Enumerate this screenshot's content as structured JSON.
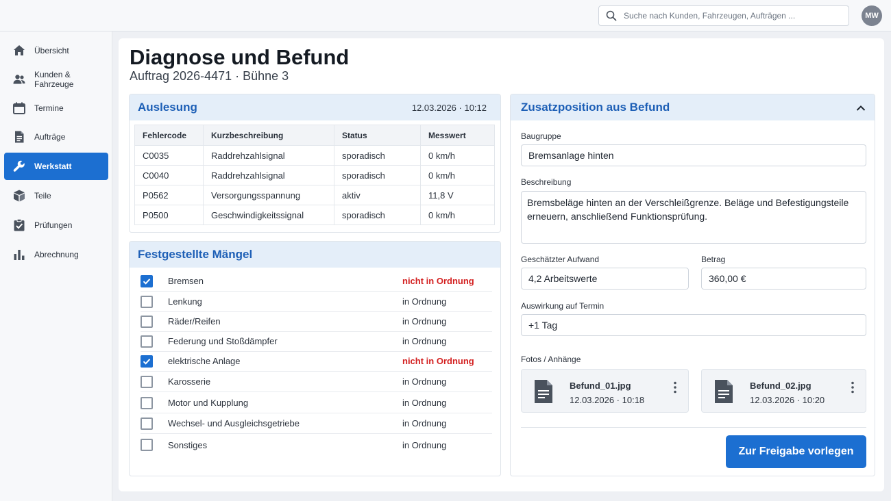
{
  "topbar": {
    "search_placeholder": "Suche nach Kunden, Fahrzeugen, Aufträgen ...",
    "avatar_initials": "MW"
  },
  "sidebar": {
    "items": [
      {
        "label": "Übersicht",
        "icon": "home-icon"
      },
      {
        "label": "Kunden & Fahrzeuge",
        "icon": "users-icon"
      },
      {
        "label": "Termine",
        "icon": "calendar-icon"
      },
      {
        "label": "Aufträge",
        "icon": "document-icon"
      },
      {
        "label": "Werkstatt",
        "icon": "wrench-icon",
        "active": true
      },
      {
        "label": "Teile",
        "icon": "box-icon"
      },
      {
        "label": "Prüfungen",
        "icon": "checklist-icon"
      },
      {
        "label": "Abrechnung",
        "icon": "bar-chart-icon"
      }
    ]
  },
  "page": {
    "title": "Diagnose und Befund",
    "subtitle": "Auftrag 2026-4471 · Bühne 3"
  },
  "readout": {
    "title": "Auslesung",
    "timestamp": "12.03.2026 · 10:12",
    "columns": [
      "Fehlercode",
      "Kurzbeschreibung",
      "Status",
      "Messwert"
    ],
    "rows": [
      [
        "C0035",
        "Raddrehzahlsignal",
        "sporadisch",
        "0 km/h"
      ],
      [
        "C0040",
        "Raddrehzahlsignal",
        "sporadisch",
        "0 km/h"
      ],
      [
        "P0562",
        "Versorgungsspannung",
        "aktiv",
        "11,8 V"
      ],
      [
        "P0500",
        "Geschwindigkeitssignal",
        "sporadisch",
        "0 km/h"
      ]
    ]
  },
  "defects": {
    "title": "Festgestellte Mängel",
    "items": [
      {
        "label": "Bremsen",
        "status": "nicht in Ordnung",
        "checked": true
      },
      {
        "label": "Lenkung",
        "status": "in Ordnung",
        "checked": false
      },
      {
        "label": "Räder/Reifen",
        "status": "in Ordnung",
        "checked": false
      },
      {
        "label": "Federung und Stoßdämpfer",
        "status": "in Ordnung",
        "checked": false
      },
      {
        "label": "elektrische Anlage",
        "status": "nicht in Ordnung",
        "checked": true
      },
      {
        "label": "Karosserie",
        "status": "in Ordnung",
        "checked": false
      },
      {
        "label": "Motor und Kupplung",
        "status": "in Ordnung",
        "checked": false
      },
      {
        "label": "Wechsel- und Ausgleichsgetriebe",
        "status": "in Ordnung",
        "checked": false
      },
      {
        "label": "Sonstiges",
        "status": "in Ordnung",
        "checked": false
      }
    ]
  },
  "extra": {
    "title": "Zusatzposition aus Befund",
    "group_label": "Baugruppe",
    "group_value": "Bremsanlage hinten",
    "description_label": "Beschreibung",
    "description_value": "Bremsbeläge hinten an der Verschleißgrenze. Beläge und Befestigungsteile erneuern, anschließend Funktionsprüfung.",
    "effort_label": "Geschätzter Aufwand",
    "effort_value": "4,2 Arbeitswerte",
    "amount_label": "Betrag",
    "amount_value": "360,00 €",
    "impact_label": "Auswirkung auf Termin",
    "impact_value": "+1 Tag",
    "photos_label": "Fotos / Anhänge",
    "attachments": [
      {
        "name": "Befund_01.jpg",
        "time": "12.03.2026 · 10:18"
      },
      {
        "name": "Befund_02.jpg",
        "time": "12.03.2026 · 10:20"
      }
    ],
    "submit_label": "Zur Freigabe vorlegen"
  },
  "colors": {
    "accent": "#1c6fd1",
    "danger": "#d32020",
    "card_header": "#e4eef9"
  }
}
